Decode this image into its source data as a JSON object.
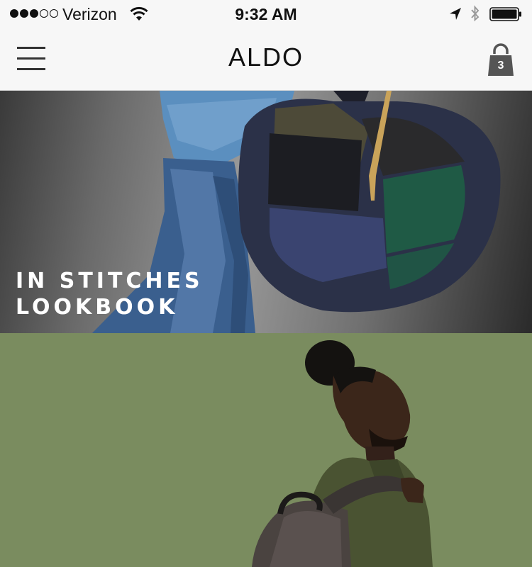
{
  "status_bar": {
    "carrier": "Verizon",
    "time": "9:32 AM",
    "signal_filled": 3,
    "signal_total": 5
  },
  "nav": {
    "logo": "ALDO",
    "cart_count": "3",
    "menu_icon": "hamburger-menu-icon",
    "cart_icon": "shopping-bag-icon"
  },
  "banners": [
    {
      "title_line1": "IN STITCHES",
      "title_line2": "LOOKBOOK"
    },
    {
      "title_line1": "",
      "title_line2": ""
    }
  ],
  "colors": {
    "bar_bg": "#f7f7f7",
    "banner2_bg": "#7a8c5f",
    "accent_green": "#1f5a45",
    "bag_navy": "#2b3148",
    "denim": "#3a5f8e"
  }
}
